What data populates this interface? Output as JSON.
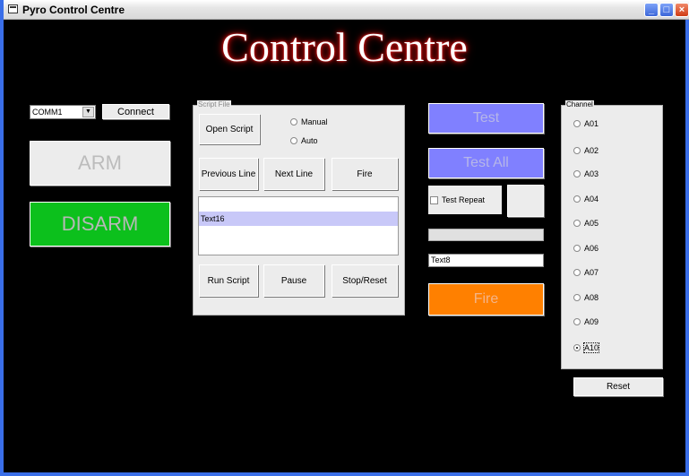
{
  "window": {
    "title": "Pyro Control Centre",
    "buttons": [
      "minimize-icon",
      "maximize-icon",
      "close-icon"
    ]
  },
  "heading": "Control Centre",
  "connection": {
    "port": "COMM1",
    "connect_label": "Connect"
  },
  "arm_label": "ARM",
  "disarm_label": "DISARM",
  "script_file": {
    "legend": "Script File",
    "open_label": "Open Script",
    "mode_options": [
      {
        "label": "Manual",
        "selected": false
      },
      {
        "label": "Auto",
        "selected": false
      }
    ],
    "previous_line_label": "Previous Line",
    "next_line_label": "Next Line",
    "fire_label": "Fire",
    "list_item": "Text16",
    "run_label": "Run Script",
    "pause_label": "Pause",
    "stop_label": "Stop/Reset"
  },
  "test": {
    "test_label": "Test",
    "test_all_label": "Test All",
    "test_repeat_label": "Test Repeat",
    "text_field": "Text8",
    "fire_label": "Fire"
  },
  "channel": {
    "legend": "Channel",
    "items": [
      {
        "label": "A01",
        "selected": false
      },
      {
        "label": "A02",
        "selected": false
      },
      {
        "label": "A03",
        "selected": false
      },
      {
        "label": "A04",
        "selected": false
      },
      {
        "label": "A05",
        "selected": false
      },
      {
        "label": "A06",
        "selected": false
      },
      {
        "label": "A07",
        "selected": false
      },
      {
        "label": "A08",
        "selected": false
      },
      {
        "label": "A09",
        "selected": false
      },
      {
        "label": "A10",
        "selected": true
      }
    ],
    "reset_label": "Reset"
  },
  "colors": {
    "arm_disabled": "#ececec",
    "disarm": "#0cc01c",
    "test": "#8080ff",
    "fire": "#ff8000",
    "titlebar_border": "#3a6ee8"
  }
}
